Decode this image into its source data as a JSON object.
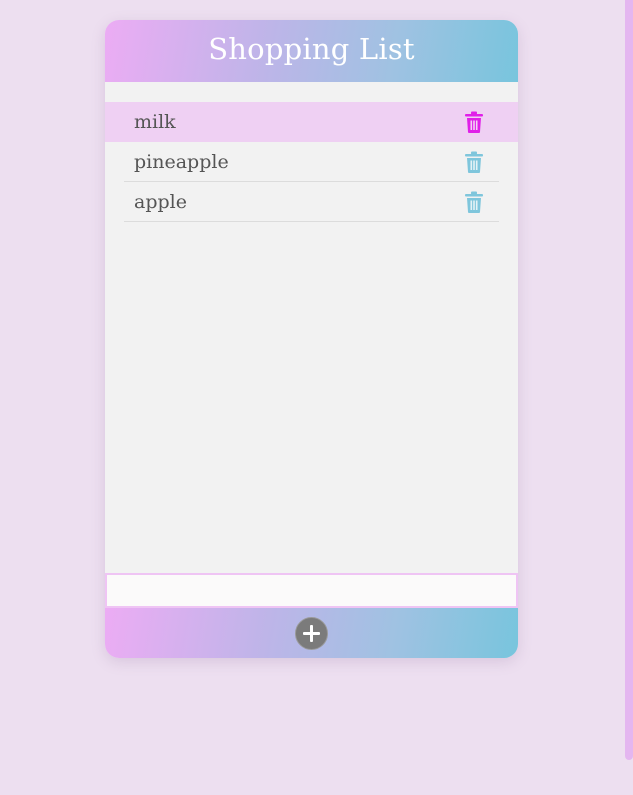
{
  "app": {
    "title": "Shopping List"
  },
  "items": [
    {
      "label": "milk",
      "selected": true
    },
    {
      "label": "pineapple",
      "selected": false
    },
    {
      "label": "apple",
      "selected": false
    }
  ],
  "new_item_input": {
    "value": "",
    "placeholder": ""
  },
  "icons": {
    "delete": "trash-icon",
    "add": "plus-icon"
  },
  "colors": {
    "background": "#eddff0",
    "selected_row": "#efd0f3",
    "trash_active": "#e020e8",
    "trash_inactive": "#7fc6dc",
    "add_button": "#7b7b7b",
    "gradient_start": "#ecacf4",
    "gradient_end": "#78c5dd"
  }
}
